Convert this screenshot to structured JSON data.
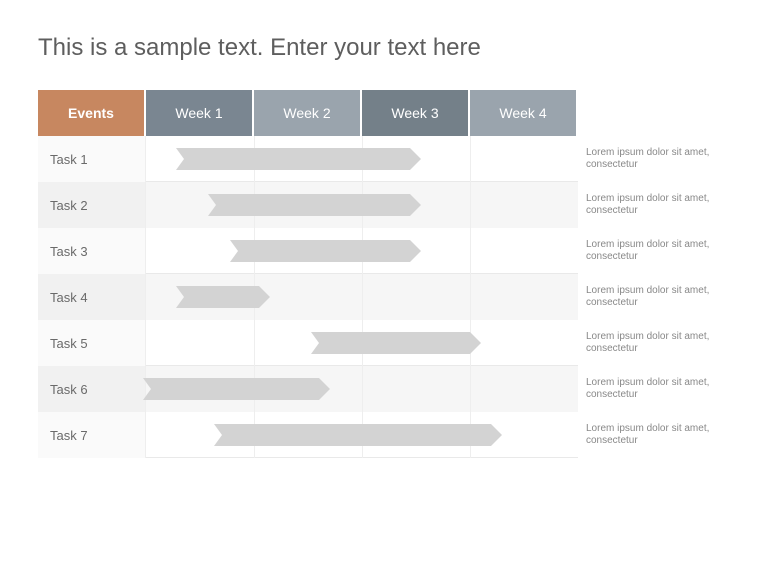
{
  "slide": {
    "title": "This is a sample text. Enter your text here"
  },
  "chart_data": {
    "type": "bar",
    "title": "",
    "xlabel": "",
    "ylabel": "",
    "events_header": "Events",
    "categories": [
      "Week 1",
      "Week 2",
      "Week 3",
      "Week 4"
    ],
    "xrange": [
      0,
      4
    ],
    "tasks": [
      {
        "name": "Task 1",
        "start": 0.35,
        "end": 2.55,
        "note": "Lorem ipsum dolor sit amet, consectetur"
      },
      {
        "name": "Task 2",
        "start": 0.65,
        "end": 2.55,
        "note": "Lorem ipsum dolor sit amet, consectetur"
      },
      {
        "name": "Task 3",
        "start": 0.85,
        "end": 2.55,
        "note": "Lorem ipsum dolor sit amet, consectetur"
      },
      {
        "name": "Task 4",
        "start": 0.35,
        "end": 1.15,
        "note": "Lorem ipsum dolor sit amet, consectetur"
      },
      {
        "name": "Task 5",
        "start": 1.6,
        "end": 3.1,
        "note": "Lorem ipsum dolor sit amet, consectetur"
      },
      {
        "name": "Task 6",
        "start": 0.05,
        "end": 1.7,
        "note": "Lorem ipsum dolor sit amet, consectetur"
      },
      {
        "name": "Task 7",
        "start": 0.7,
        "end": 3.3,
        "note": "Lorem ipsum dolor sit amet, consectetur"
      }
    ],
    "colors": {
      "events_header": "#c78760",
      "week_headers": [
        "#7a8691",
        "#9aa4ad",
        "#748089",
        "#9aa4ad"
      ],
      "bar": "#d3d3d3"
    }
  }
}
